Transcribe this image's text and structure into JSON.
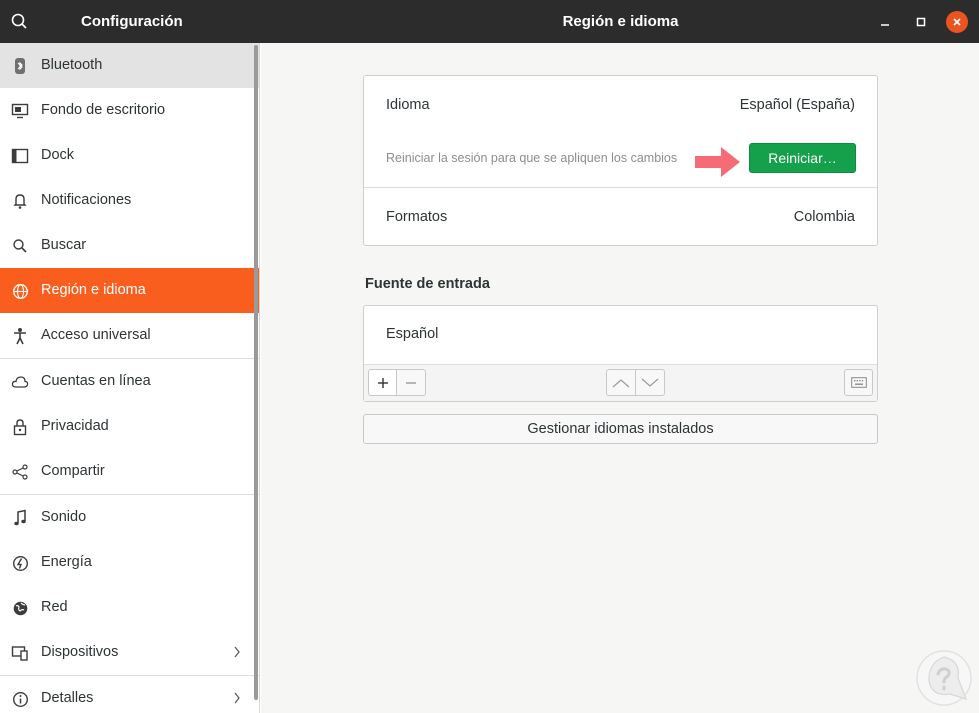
{
  "window": {
    "app_title": "Configuración",
    "page_title": "Región e idioma"
  },
  "sidebar": {
    "items": [
      {
        "label": "Bluetooth",
        "icon": "bluetooth-icon"
      },
      {
        "label": "Fondo de escritorio",
        "icon": "desktop-background-icon"
      },
      {
        "label": "Dock",
        "icon": "dock-icon"
      },
      {
        "label": "Notificaciones",
        "icon": "bell-icon"
      },
      {
        "label": "Buscar",
        "icon": "search-icon"
      },
      {
        "label": "Región e idioma",
        "icon": "globe-icon"
      },
      {
        "label": "Acceso universal",
        "icon": "accessibility-icon"
      },
      {
        "label": "Cuentas en línea",
        "icon": "cloud-icon"
      },
      {
        "label": "Privacidad",
        "icon": "lock-icon"
      },
      {
        "label": "Compartir",
        "icon": "share-icon"
      },
      {
        "label": "Sonido",
        "icon": "music-note-icon"
      },
      {
        "label": "Energía",
        "icon": "power-icon"
      },
      {
        "label": "Red",
        "icon": "network-icon"
      },
      {
        "label": "Dispositivos",
        "icon": "devices-icon"
      },
      {
        "label": "Detalles",
        "icon": "details-icon"
      }
    ],
    "active": "Región e idioma",
    "hovered": "Bluetooth"
  },
  "language_card": {
    "language_label": "Idioma",
    "language_value": "Español (España)",
    "restart_hint": "Reiniciar la sesión para que se apliquen los cambios",
    "restart_button": "Reiniciar…",
    "formats_label": "Formatos",
    "formats_value": "Colombia"
  },
  "input_sources": {
    "title": "Fuente de entrada",
    "items": [
      "Español"
    ]
  },
  "manage_button": "Gestionar idiomas instalados",
  "colors": {
    "accent": "#f95e1f",
    "titlebar": "#2c2c2c",
    "restart_button": "#15a14b",
    "annotation_arrow": "#f4606b"
  }
}
